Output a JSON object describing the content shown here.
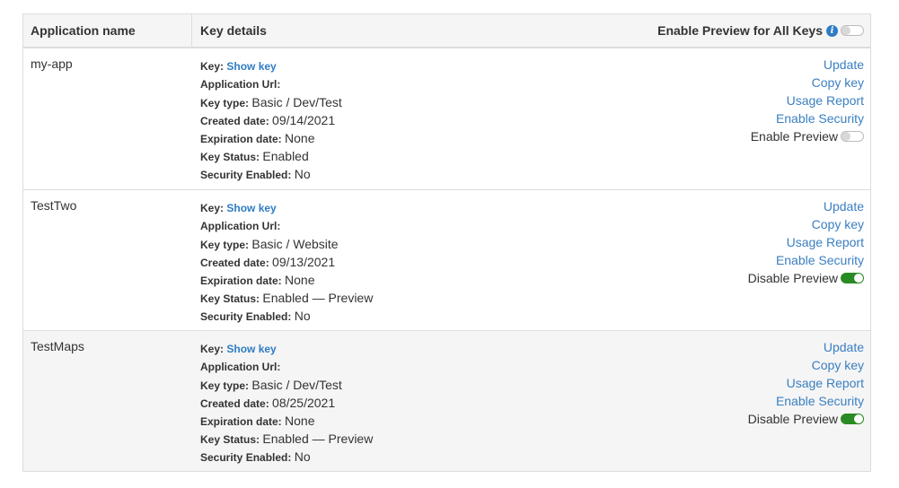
{
  "header": {
    "app_name": "Application name",
    "key_details": "Key details",
    "enable_all": "Enable Preview for All Keys",
    "info_icon": "i"
  },
  "labels": {
    "key": "Key:",
    "show_key": "Show key",
    "app_url": "Application Url:",
    "key_type": "Key type:",
    "created": "Created date:",
    "expiration": "Expiration date:",
    "status": "Key Status:",
    "security": "Security Enabled:"
  },
  "rows": [
    {
      "name": "my-app",
      "key_type": "Basic / Dev/Test",
      "created": "09/14/2021",
      "expiration": "None",
      "status": "Enabled",
      "security": "No",
      "actions": {
        "update": "Update",
        "copy": "Copy key",
        "usage": "Usage Report",
        "enable_security": "Enable Security"
      },
      "preview_label": "Enable Preview",
      "preview_on": false
    },
    {
      "name": "TestTwo",
      "key_type": "Basic / Website",
      "created": "09/13/2021",
      "expiration": "None",
      "status": "Enabled — Preview",
      "security": "No",
      "actions": {
        "update": "Update",
        "copy": "Copy key",
        "usage": "Usage Report",
        "enable_security": "Enable Security"
      },
      "preview_label": "Disable Preview",
      "preview_on": true
    },
    {
      "name": "TestMaps",
      "key_type": "Basic / Dev/Test",
      "created": "08/25/2021",
      "expiration": "None",
      "status": "Enabled — Preview",
      "security": "No",
      "actions": {
        "update": "Update",
        "copy": "Copy key",
        "usage": "Usage Report",
        "enable_security": "Enable Security"
      },
      "preview_label": "Disable Preview",
      "preview_on": true
    }
  ],
  "colors": {
    "link": "#3a7fc1",
    "toggle_on": "#2a8a24",
    "row_shade": "#f5f5f5",
    "border": "#dddddd"
  }
}
